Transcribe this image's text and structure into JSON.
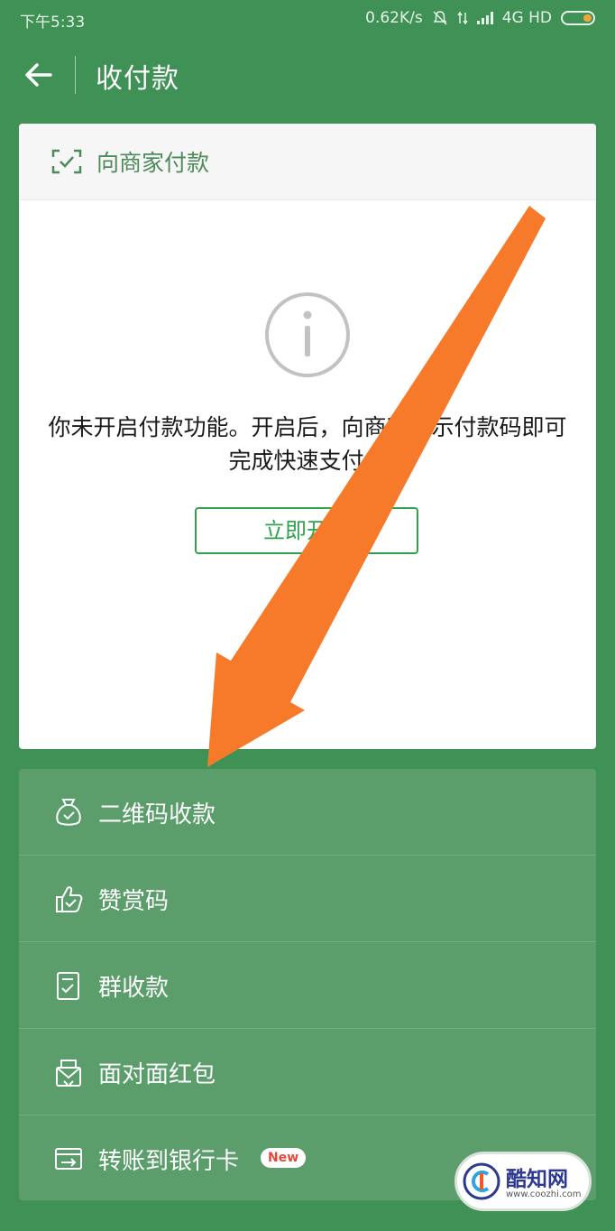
{
  "status_bar": {
    "time": "下午5:33",
    "speed": "0.62K/s",
    "network": "4G HD"
  },
  "app_bar": {
    "title": "收付款"
  },
  "pay_card": {
    "title": "向商家付款",
    "notice": "你未开启付款功能。开启后，向商家出示付款码即可完成快速支付。",
    "button_label": "立即开启"
  },
  "menu": {
    "items": [
      {
        "label": "二维码收款",
        "icon": "money-bag-icon"
      },
      {
        "label": "赞赏码",
        "icon": "thumbs-up-icon"
      },
      {
        "label": "群收款",
        "icon": "group-collect-icon"
      },
      {
        "label": "面对面红包",
        "icon": "red-packet-icon"
      },
      {
        "label": "转账到银行卡",
        "icon": "bank-card-icon",
        "badge": "New"
      }
    ]
  },
  "watermark": {
    "name": "酷知网",
    "url": "www.coozhi.com"
  },
  "colors": {
    "background": "#3f9155",
    "accent_green": "#2fa34b",
    "annotation_arrow": "#f77a2a",
    "menu_background": "#5c9d6c"
  }
}
